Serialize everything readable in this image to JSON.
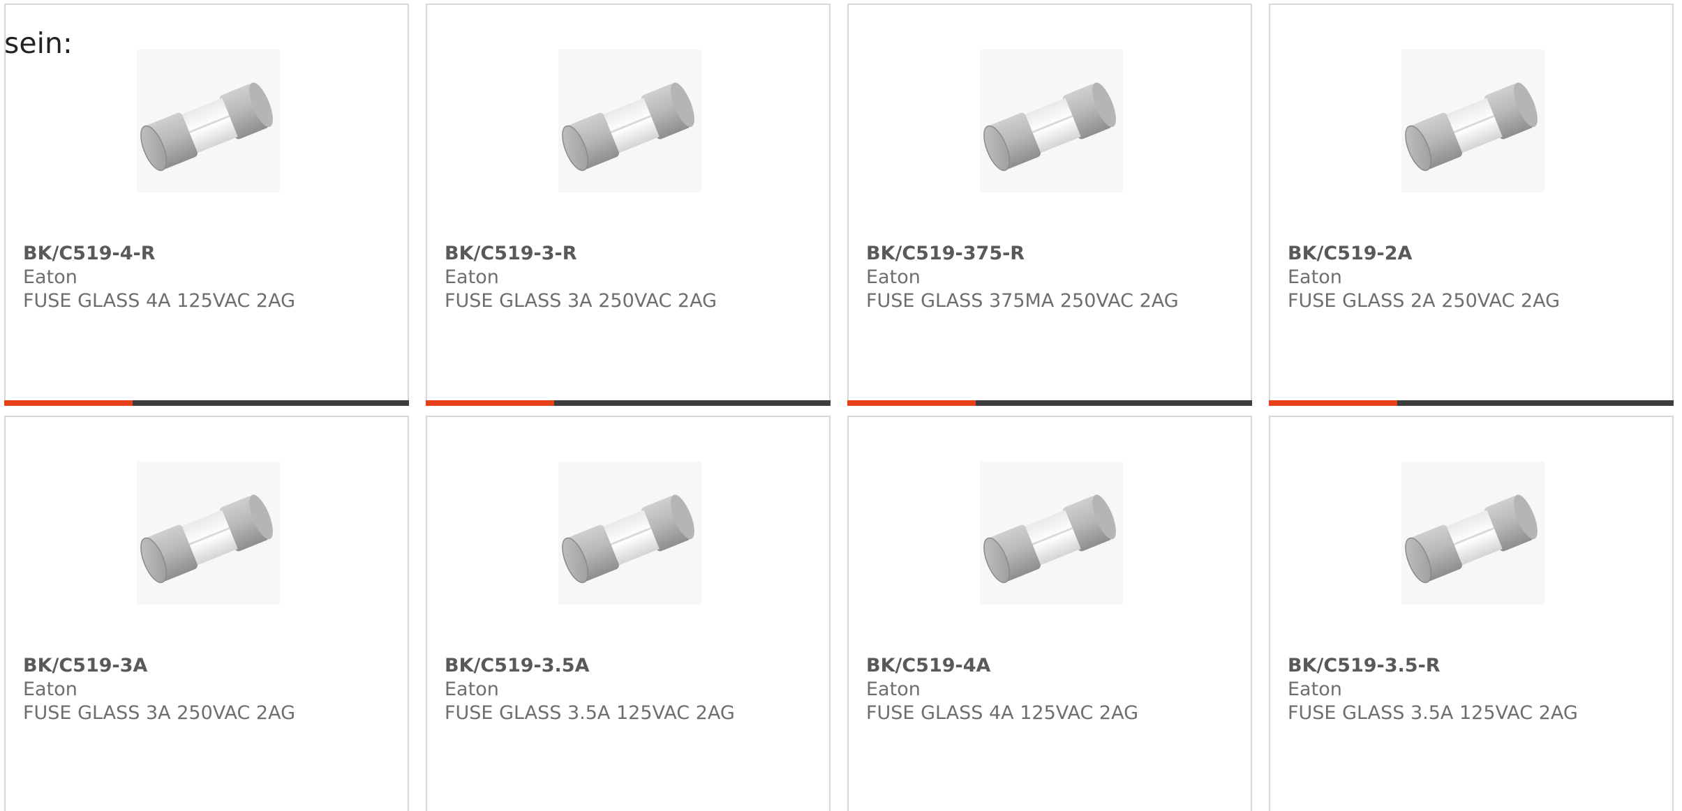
{
  "intro": {
    "text": "sein:"
  },
  "colors": {
    "accent": "#e8401c",
    "bar_dark": "#3d3d3d",
    "border": "#d8d8d8"
  },
  "products": [
    {
      "part_number": "BK/C519-4-R",
      "manufacturer": "Eaton",
      "description": "FUSE GLASS 4A 125VAC 2AG",
      "image_icon": "glass-fuse-icon"
    },
    {
      "part_number": "BK/C519-3-R",
      "manufacturer": "Eaton",
      "description": "FUSE GLASS 3A 250VAC 2AG",
      "image_icon": "glass-fuse-icon"
    },
    {
      "part_number": "BK/C519-375-R",
      "manufacturer": "Eaton",
      "description": "FUSE GLASS 375MA 250VAC 2AG",
      "image_icon": "glass-fuse-icon"
    },
    {
      "part_number": "BK/C519-2A",
      "manufacturer": "Eaton",
      "description": "FUSE GLASS 2A 250VAC 2AG",
      "image_icon": "glass-fuse-icon"
    },
    {
      "part_number": "BK/C519-3A",
      "manufacturer": "Eaton",
      "description": "FUSE GLASS 3A 250VAC 2AG",
      "image_icon": "glass-fuse-icon"
    },
    {
      "part_number": "BK/C519-3.5A",
      "manufacturer": "Eaton",
      "description": "FUSE GLASS 3.5A 125VAC 2AG",
      "image_icon": "glass-fuse-icon"
    },
    {
      "part_number": "BK/C519-4A",
      "manufacturer": "Eaton",
      "description": "FUSE GLASS 4A 125VAC 2AG",
      "image_icon": "glass-fuse-icon"
    },
    {
      "part_number": "BK/C519-3.5-R",
      "manufacturer": "Eaton",
      "description": "FUSE GLASS 3.5A 125VAC 2AG",
      "image_icon": "glass-fuse-icon"
    }
  ]
}
